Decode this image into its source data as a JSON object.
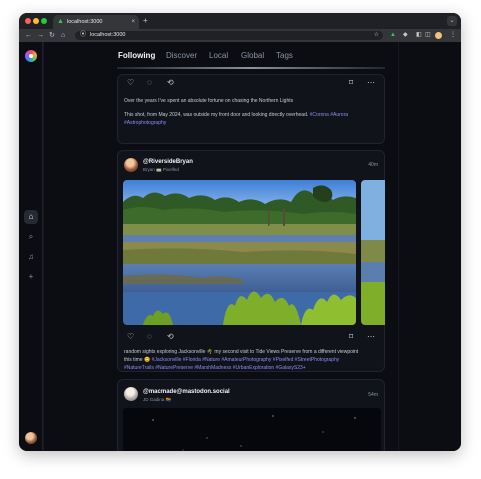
{
  "browser": {
    "tab_title": "localhost:3000",
    "tab_close": "×",
    "new_tab": "+",
    "tab_menu": "⌄",
    "url": "localhost:3000",
    "nav": {
      "back": "←",
      "forward": "→",
      "reload": "↻",
      "home": "⌂"
    },
    "extensions": [
      "▲",
      "◆",
      "◧",
      "◫",
      "⋮"
    ],
    "star": "☆",
    "site_info": "⦿"
  },
  "sidebar": {
    "home_icon": "⌂",
    "search_icon": "⌕",
    "notifications_icon": "♫",
    "add_icon": "+"
  },
  "topnav": {
    "tabs": [
      {
        "label": "Following",
        "active": true
      },
      {
        "label": "Discover",
        "active": false
      },
      {
        "label": "Local",
        "active": false
      },
      {
        "label": "Global",
        "active": false
      },
      {
        "label": "Tags",
        "active": false
      }
    ]
  },
  "icons": {
    "like": "♡",
    "reply": "◌",
    "boost": "⟲",
    "bookmark": "⌑",
    "more": "⋯"
  },
  "posts": [
    {
      "lines": [
        {
          "text": "Over the years I've spent an absolute fortune on chasing the Northern Lights",
          "tags": ""
        },
        {
          "text": "This shot, from May 2024, was outside my front door and looking directly overhead.",
          "tags": "#Corona #Aurora"
        },
        {
          "text": "",
          "tags": "#Astrophotography"
        }
      ]
    },
    {
      "display_name": "@RiversideBryan",
      "account": "Bryan 🚃 Pixelfed",
      "time": "40m",
      "lines": [
        {
          "text": "random sights exploring Jacksonville 🌴 my second visit to Tide Views Preserve from a different viewpoint",
          "tags": ""
        },
        {
          "text": "this time 😊",
          "tags": "#Jacksonville #Florida #Nature #AmateurPhotography #Pixelfed #StreetPhotography"
        },
        {
          "text": "",
          "tags": "#NatureTrails #NaturePreserve #MarshMadness #UrbanExploration #GalaxyS23+"
        }
      ]
    },
    {
      "display_name": "@macmade@mastodon.social",
      "account": "JD Gadina 🏳️‍🌈",
      "time": "54m"
    }
  ],
  "scroll_icon": "⇅"
}
